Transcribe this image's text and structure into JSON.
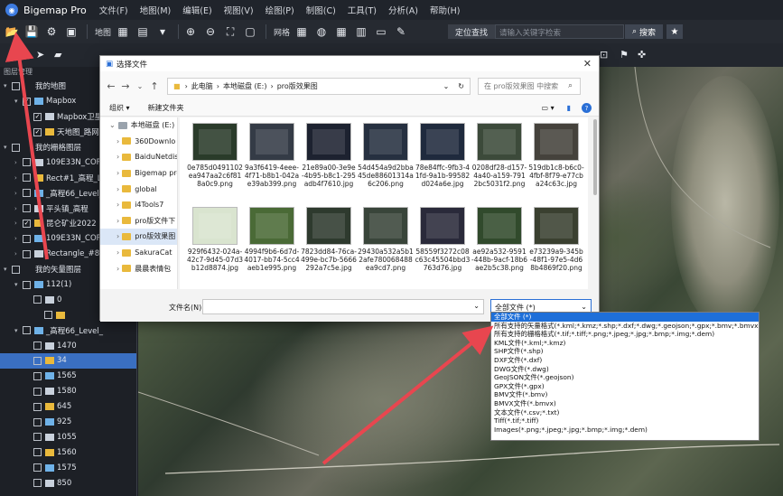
{
  "app": {
    "title": "Bigemap Pro",
    "menus": [
      "文件(F)",
      "地图(M)",
      "编辑(E)",
      "视图(V)",
      "绘图(P)",
      "制图(C)",
      "工具(T)",
      "分析(A)",
      "帮助(H)"
    ]
  },
  "toolbar": {
    "map_label": "地图",
    "grid_label": "网格",
    "location_label": "定位查找",
    "search_placeholder": "请输入关键字检索",
    "search_button": "搜索"
  },
  "panel": {
    "header": "图层管理",
    "items": [
      {
        "label": "我的地图",
        "indent": 0,
        "caret": "▾",
        "check": false
      },
      {
        "label": "Mapbox",
        "indent": 1,
        "caret": "▾",
        "check": true
      },
      {
        "label": "Mapbox卫星",
        "indent": 2,
        "caret": "",
        "check": true
      },
      {
        "label": "天地图_路网",
        "indent": 2,
        "caret": "",
        "check": true
      },
      {
        "label": "我的栅格图层",
        "indent": 0,
        "caret": "▾",
        "check": false
      },
      {
        "label": "109E33N_COP",
        "indent": 1,
        "caret": "›",
        "check": false
      },
      {
        "label": "Rect#1_高程_Level",
        "indent": 1,
        "caret": "›",
        "check": false
      },
      {
        "label": "_高程66_Level_",
        "indent": 1,
        "caret": "›",
        "check": false
      },
      {
        "label": "平头镇_高程",
        "indent": 1,
        "caret": "›",
        "check": false
      },
      {
        "label": "昆仑矿业2022",
        "indent": 1,
        "caret": "›",
        "check": true
      },
      {
        "label": "109E33N_COP",
        "indent": 1,
        "caret": "›",
        "check": false
      },
      {
        "label": "Rectangle_#8_",
        "indent": 1,
        "caret": "›",
        "check": false
      },
      {
        "label": "我的矢量图层",
        "indent": 0,
        "caret": "▾",
        "check": false
      },
      {
        "label": "112(1)",
        "indent": 1,
        "caret": "▾",
        "check": false
      },
      {
        "label": "0",
        "indent": 2,
        "caret": "",
        "check": false
      },
      {
        "label": "",
        "indent": 3,
        "caret": "",
        "check": false
      },
      {
        "label": "_高程66_Level_",
        "indent": 1,
        "caret": "▾",
        "check": false
      },
      {
        "label": "1470",
        "indent": 2,
        "caret": "",
        "check": false
      },
      {
        "label": "34",
        "indent": 2,
        "caret": "",
        "check": false,
        "selected": true
      },
      {
        "label": "1565",
        "indent": 2,
        "caret": "",
        "check": false
      },
      {
        "label": "1580",
        "indent": 2,
        "caret": "",
        "check": false
      },
      {
        "label": "645",
        "indent": 2,
        "caret": "",
        "check": false
      },
      {
        "label": "925",
        "indent": 2,
        "caret": "",
        "check": false
      },
      {
        "label": "1055",
        "indent": 2,
        "caret": "",
        "check": false
      },
      {
        "label": "1560",
        "indent": 2,
        "caret": "",
        "check": false
      },
      {
        "label": "1575",
        "indent": 2,
        "caret": "",
        "check": false
      },
      {
        "label": "850",
        "indent": 2,
        "caret": "",
        "check": false
      }
    ]
  },
  "dialog": {
    "title": "选择文件",
    "breadcrumb": [
      "此电脑",
      "本地磁盘 (E:)",
      "pro版效果图"
    ],
    "search_placeholder": "在 pro版效果图 中搜索",
    "organize": "组织 ▾",
    "new_folder": "新建文件夹",
    "nav": [
      {
        "label": "本地磁盘 (E:)",
        "level": 0
      },
      {
        "label": "360Downlo",
        "level": 1
      },
      {
        "label": "BaiduNetdis",
        "level": 1
      },
      {
        "label": "Bigemap pro",
        "level": 1
      },
      {
        "label": "global",
        "level": 1
      },
      {
        "label": "i4Tools7",
        "level": 1
      },
      {
        "label": "pro版文件下",
        "level": 1
      },
      {
        "label": "pro版效果图",
        "level": 1,
        "selected": true
      },
      {
        "label": "SakuraCat",
        "level": 1
      },
      {
        "label": "晨晨表情包",
        "level": 1
      }
    ],
    "files": [
      {
        "name": "0e785d0491102ea947aa2c6f818a0c9.png",
        "color": "#2a3b2a"
      },
      {
        "name": "9a3f6419-4eee-4f71-b8b1-042ae39ab399.png",
        "color": "#343b46"
      },
      {
        "name": "21e89a00-3e9e-4b95-b8c1-295adb4f7610.jpg",
        "color": "#1d2230"
      },
      {
        "name": "54d454a9d2bba45de88601314a6c206.png",
        "color": "#263040"
      },
      {
        "name": "78e84ffc-9fb3-41fd-9a1b-99582d024a6e.jpg",
        "color": "#1f2a3d"
      },
      {
        "name": "0208df28-d157-4a40-a159-7912bc5031f2.png",
        "color": "#3c4a3a"
      },
      {
        "name": "519db1c8-b6c0-4fbf-8f79-e77cba24c63c.jpg",
        "color": "#45423c"
      },
      {
        "name": "929f6432-024a-42c7-9d45-07d3b12d8874.jpg",
        "color": "#d9e4cf"
      },
      {
        "name": "4994f9b6-6d7d-4017-bb74-5cc4aeb1e995.png",
        "color": "#4a6a36"
      },
      {
        "name": "7823dd84-76ca-499e-bc7b-5666292a7c5e.jpg",
        "color": "#2e3a2e"
      },
      {
        "name": "29430a532a5b12afe780068488ea9cd7.png",
        "color": "#39453a"
      },
      {
        "name": "58559f3272c08c63c45504bbd3763d76.jpg",
        "color": "#2a2a3a"
      },
      {
        "name": "ae92a532-9591-448b-9acf-18b6ae2b5c38.png",
        "color": "#314a2c"
      },
      {
        "name": "e73239a9-345b-48f1-97e5-4d6 8b4869f20.png",
        "color": "#3a4030"
      }
    ],
    "filename_label": "文件名(N):",
    "filetype_value": "全部文件 (*)"
  },
  "dropdown": {
    "items": [
      "全部文件 (*)",
      "所有支持的矢量格式(*.kml;*.kmz;*.shp;*.dxf;*.dwg;*.geojson;*.gpx;*.bmv;*.bmvx;*.csv;*.txt)",
      "所有支持的栅格格式(*.tif;*.tiff;*.png;*.jpeg;*.jpg;*.bmp;*.img;*.dem)",
      "KML文件(*.kml;*.kmz)",
      "SHP文件(*.shp)",
      "DXF文件(*.dxf)",
      "DWG文件(*.dwg)",
      "GeoJSON文件(*.geojson)",
      "GPX文件(*.gpx)",
      "BMV文件(*.bmv)",
      "BMVX文件(*.bmvx)",
      "文本文件(*.csv;*.txt)",
      "Tiff(*.tif;*.tiff)",
      "Images(*.png;*.jpeg;*.jpg;*.bmp;*.img;*.dem)"
    ],
    "selected_index": 0
  },
  "colors": {
    "accent": "#1e6fd9",
    "arrow": "#e8464f"
  }
}
